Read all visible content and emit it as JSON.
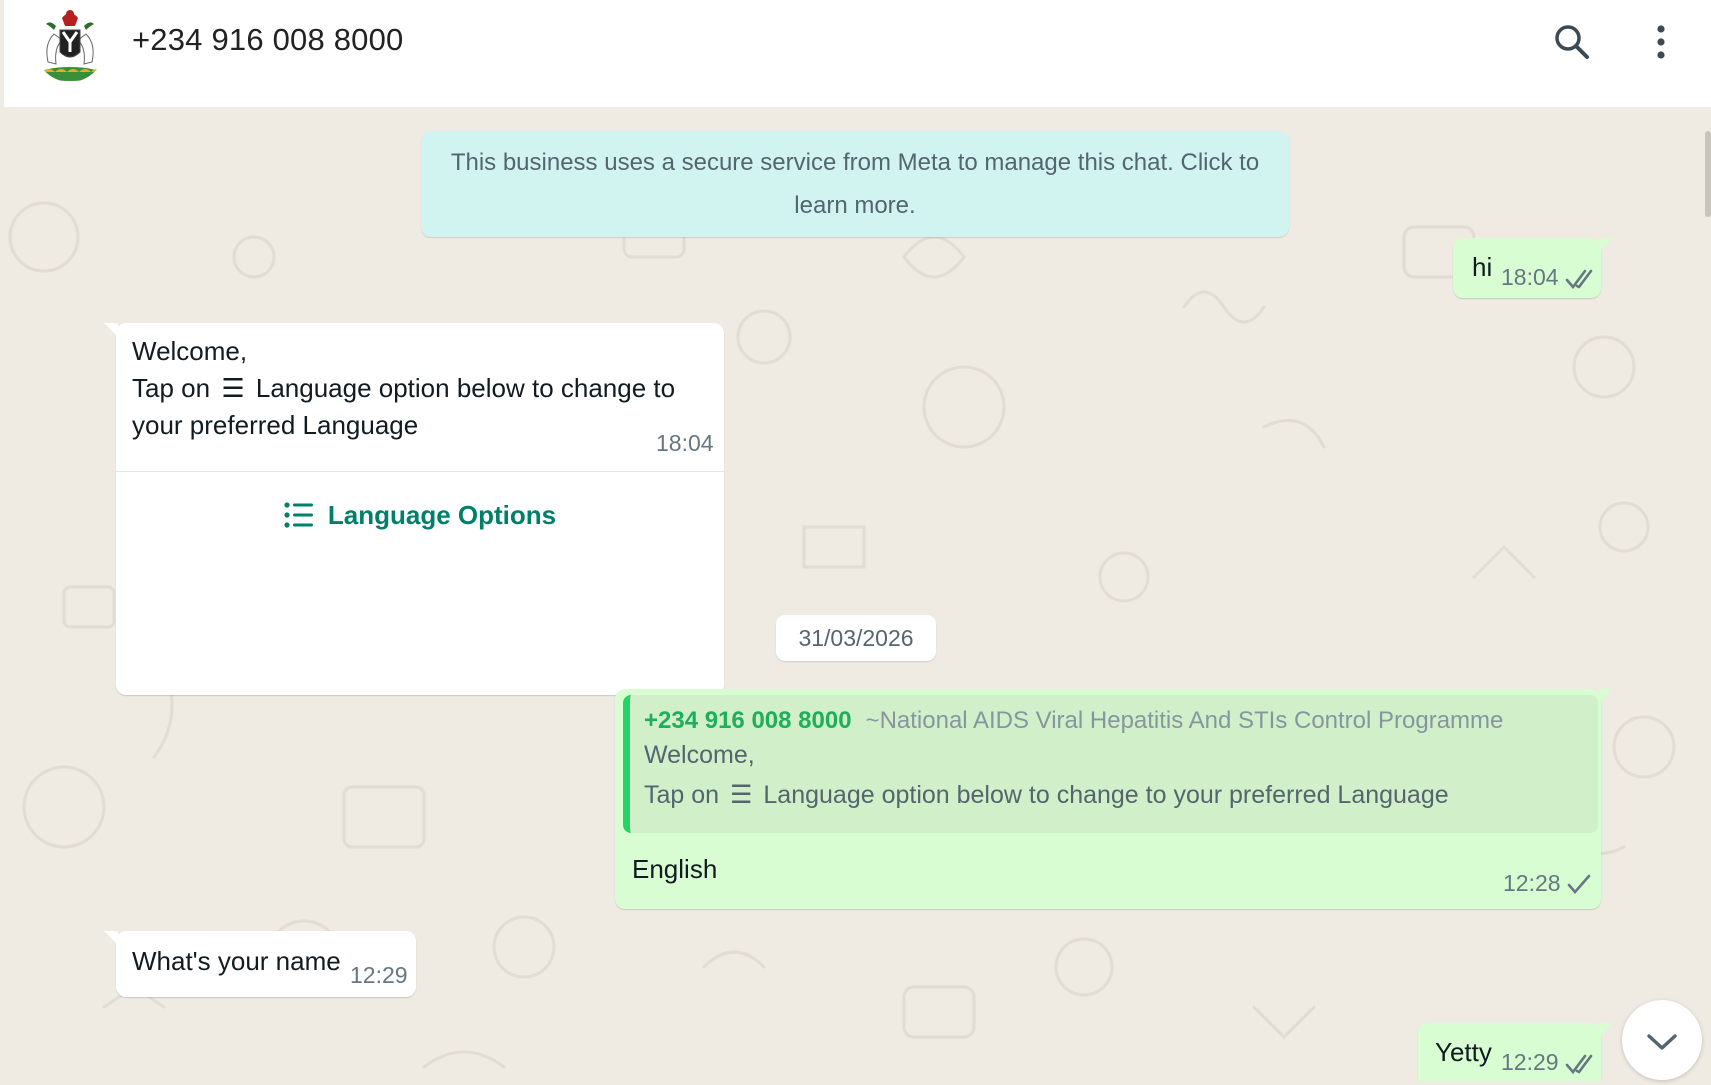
{
  "header": {
    "contact_name": "+234 916 008 8000",
    "avatar_icon": "nigeria-coat-of-arms",
    "search_icon": "search-icon",
    "menu_icon": "kebab-menu-icon"
  },
  "notice": {
    "text": "This business uses a secure service from Meta to manage this chat. Click to learn more."
  },
  "messages": [
    {
      "direction": "outgoing",
      "text": "hi",
      "time": "18:04",
      "status": "read"
    },
    {
      "direction": "incoming",
      "line1": "Welcome,",
      "line2_prefix": "Tap on",
      "line2_symbol": "☰",
      "line2_rest": "Language option below to change to",
      "line3": "your preferred Language",
      "time": "18:04",
      "button_label": "Language Options",
      "button_icon": "list-icon"
    },
    {
      "direction": "outgoing",
      "quote": {
        "sender": "+234 916 008 8000",
        "sender_label": "~National AIDS Viral Hepatitis And STIs Control Programme",
        "line1": "Welcome,",
        "line2_prefix": "Tap on",
        "line2_symbol": "☰",
        "line2_rest": "Language option below to change to your preferred Language"
      },
      "text": "English",
      "time": "12:28",
      "status": "sent"
    },
    {
      "direction": "incoming",
      "text": "What's your name",
      "time": "12:29"
    },
    {
      "direction": "outgoing",
      "text": "Yetty",
      "time": "12:29",
      "status": "read"
    }
  ],
  "date_divider": "31/03/2026",
  "colors": {
    "outgoing_bubble": "#d9fdd3",
    "incoming_bubble": "#ffffff",
    "accent_green": "#008069",
    "notice_bg": "#d1f4f1",
    "chat_bg": "#efeae2"
  }
}
